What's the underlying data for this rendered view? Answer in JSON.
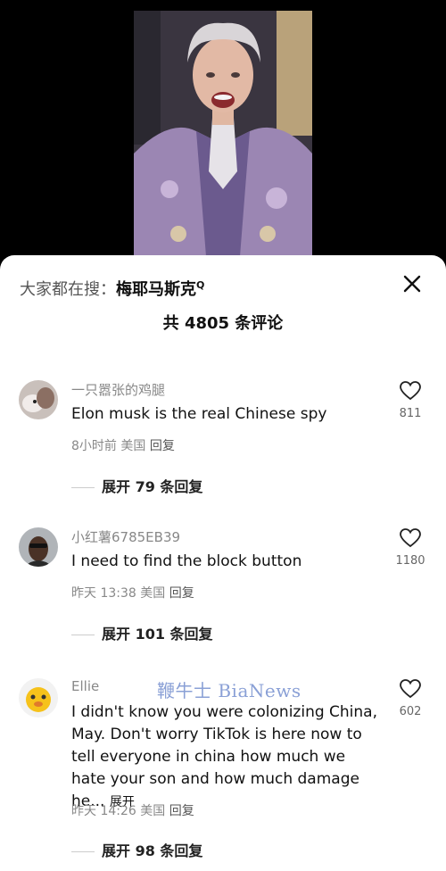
{
  "search": {
    "prefix": "大家都在搜：",
    "term": "梅耶马斯克",
    "q_mark": "Q"
  },
  "count_label": "共 4805 条评论",
  "watermark": "鞭牛士 BiaNews",
  "comments": [
    {
      "user": "一只嚣张的鸡腿",
      "text": "Elon musk is the real Chinese spy",
      "time": "8小时前",
      "location": "美国",
      "reply_label": "回复",
      "likes": "811",
      "replies_label": "展开 79 条回复"
    },
    {
      "user": "小红薯6785EB39",
      "text": "I need to find the block button",
      "time": "昨天 13:38",
      "location": "美国",
      "reply_label": "回复",
      "likes": "1180",
      "replies_label": "展开 101 条回复"
    },
    {
      "user": "Ellie",
      "text": "I didn't know you were colonizing China, May. Don't worry TikTok is here now to tell everyone in china how much we hate your son and how much damage he...",
      "expand_label": "展开",
      "time": "昨天 14:26",
      "location": "美国",
      "reply_label": "回复",
      "likes": "602",
      "replies_label": "展开 98 条回复"
    }
  ],
  "icons": {
    "close": "close-icon",
    "like": "heart-outline-icon",
    "search": "search-icon"
  }
}
